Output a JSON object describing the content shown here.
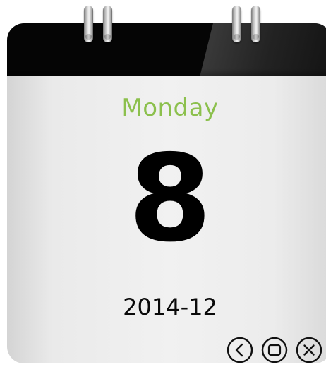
{
  "calendar": {
    "weekday": "Monday",
    "day": "8",
    "year_month": "2014-12"
  },
  "controls": [
    {
      "icon": "back-icon"
    },
    {
      "icon": "restore-icon"
    },
    {
      "icon": "close-icon"
    }
  ],
  "colors": {
    "weekday_text": "#8cc04d",
    "header": "#050505",
    "page": "#f1f1f1"
  }
}
